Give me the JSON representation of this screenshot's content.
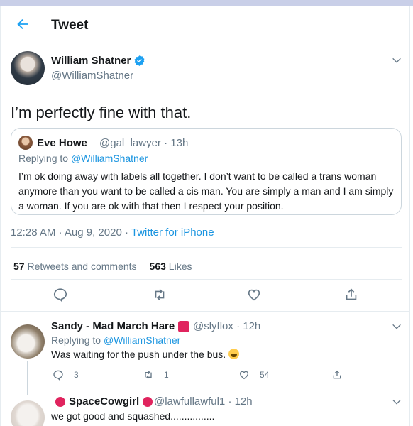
{
  "header": {
    "title": "Tweet"
  },
  "tweet": {
    "author_name": "William Shatner",
    "author_handle": "@WilliamShatner",
    "text": "I’m perfectly fine with that.",
    "timestamp": "12:28 AM · Aug 9, 2020 · ",
    "source": "Twitter for iPhone",
    "retweets_count": "57",
    "retweets_label": "Retweets and comments",
    "likes_count": "563",
    "likes_label": "Likes"
  },
  "quote": {
    "author_name": "Eve Howe",
    "author_handle": "@gal_lawyer",
    "time": "· 13h",
    "replying_prefix": "Replying to ",
    "replying_to": "@WilliamShatner",
    "text": "I’m ok doing away with labels all together. I don’t want to be called a trans woman anymore than you want to be called a cis man. You are simply a man and I am simply a woman. If you are ok with that then I respect your position."
  },
  "replies": [
    {
      "author_name": "Sandy - Mad March Hare",
      "author_handle": "@slyflox",
      "time": "· 12h",
      "replying_prefix": "Replying to ",
      "replying_to": "@WilliamShatner",
      "text": "Was waiting for the push under the bus.",
      "reply_count": "3",
      "retweet_count": "1",
      "like_count": "54"
    },
    {
      "author_name": "SpaceCowgirl",
      "author_handle": "@lawfullawful1",
      "time": "· 12h",
      "text": "we got good and squashed................"
    }
  ],
  "colors": {
    "accent": "#1da1f2",
    "muted": "#657786",
    "badge_red": "#e0245e"
  }
}
